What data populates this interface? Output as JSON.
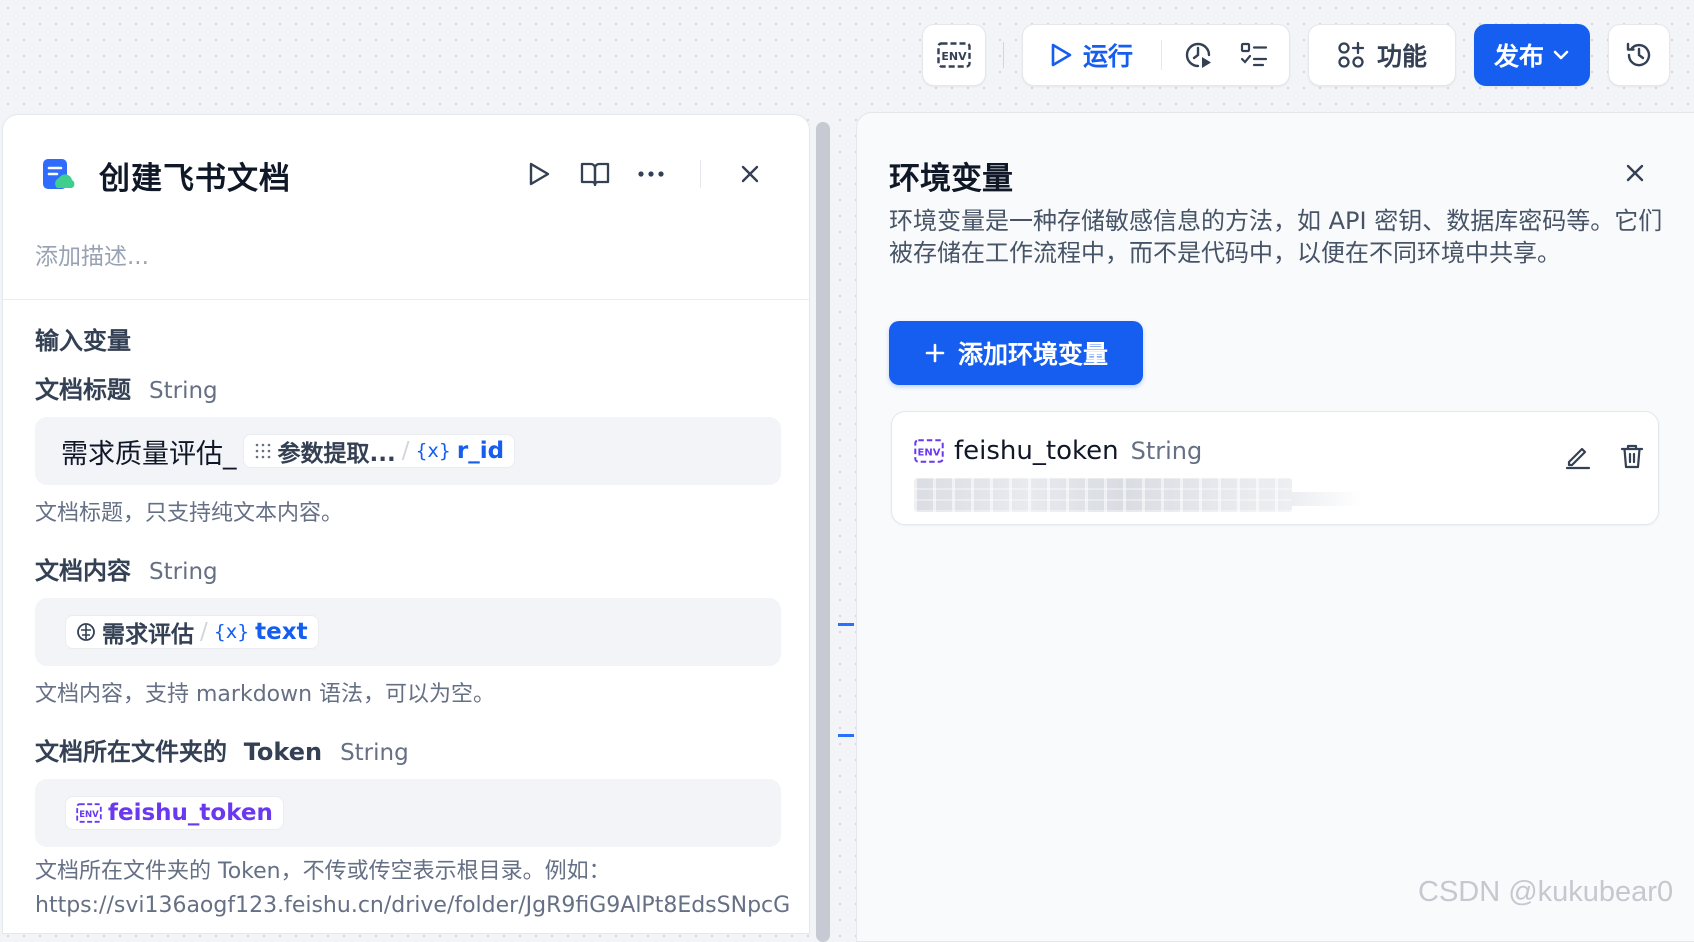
{
  "toolbar": {
    "env_icon_text": "ENV",
    "run_label": "运行",
    "features_label": "功能",
    "publish_label": "发布",
    "colors": {
      "primary": "#155eef"
    }
  },
  "node_panel": {
    "title": "创建飞书文档",
    "description_placeholder": "添加描述...",
    "section_title": "输入变量",
    "fields": [
      {
        "label": "文档标题",
        "type": "String",
        "value_prefix": "需求质量评估_",
        "ref_node": "参数提取...",
        "ref_var": "r_id",
        "hint": "文档标题，只支持纯文本内容。"
      },
      {
        "label": "文档内容",
        "type": "String",
        "ref_node": "需求评估",
        "ref_var": "text",
        "hint": "文档内容，支持 markdown 语法，可以为空。"
      },
      {
        "label": "文档所在文件夹的  Token",
        "type": "String",
        "env_var": "feishu_token",
        "hint_line1": "文档所在文件夹的 Token，不传或传空表示根目录。例如：",
        "hint_line2": "https://svi136aogf123.feishu.cn/drive/folder/JgR9fiG9AlPt8EdsSNpcG"
      }
    ]
  },
  "env_panel": {
    "title": "环境变量",
    "description": "环境变量是一种存储敏感信息的方法，如 API 密钥、数据库密码等。它们被存储在工作流程中，而不是代码中，以便在不同环境中共享。",
    "add_button": "添加环境变量",
    "variables": [
      {
        "name": "feishu_token",
        "type": "String"
      }
    ]
  },
  "watermark": "CSDN @kukubear0"
}
